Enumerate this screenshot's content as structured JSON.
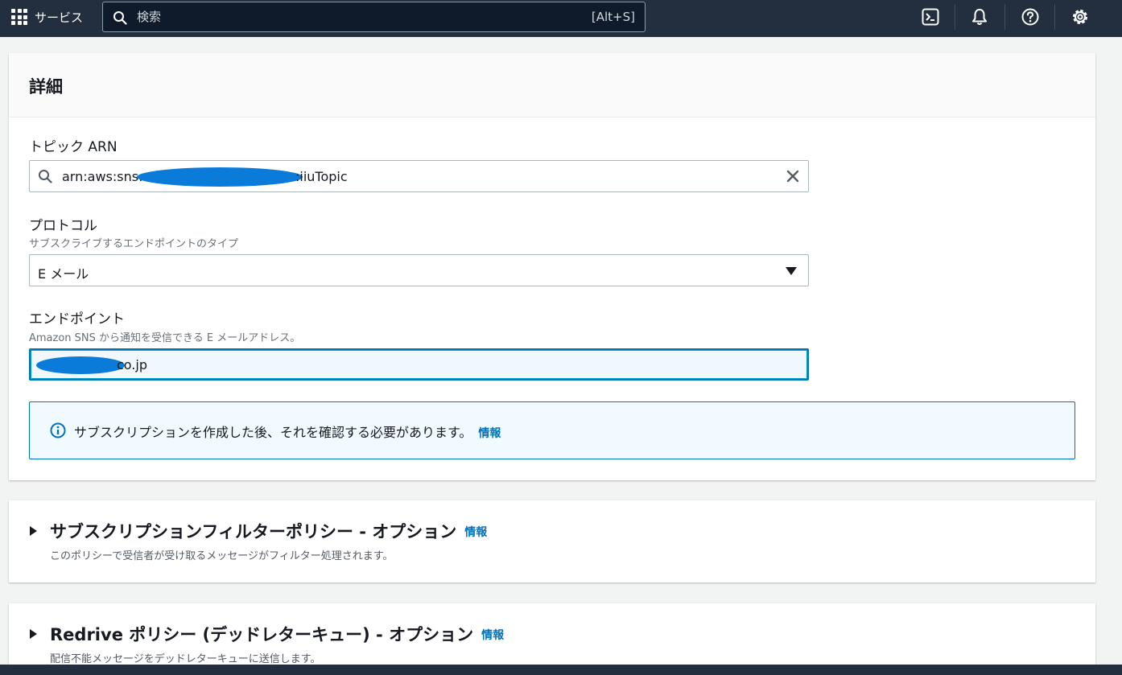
{
  "topnav": {
    "services_label": "サービス",
    "search_placeholder": "検索",
    "search_shortcut": "[Alt+S]",
    "icons": [
      "cloudshell-icon",
      "bell-icon",
      "help-icon",
      "gear-icon"
    ]
  },
  "details": {
    "title": "詳細",
    "topic_arn": {
      "label": "トピック ARN",
      "value_prefix": "arn:aws:sns:",
      "value_suffix": ":iiuTopic"
    },
    "protocol": {
      "label": "プロトコル",
      "description": "サブスクライブするエンドポイントのタイプ",
      "selected": "E メール"
    },
    "endpoint": {
      "label": "エンドポイント",
      "description": "Amazon SNS から通知を受信できる E メールアドレス。",
      "value_suffix": "co.jp"
    },
    "alert": {
      "text": "サブスクリプションを作成した後、それを確認する必要があります。",
      "link": "情報"
    }
  },
  "sections": [
    {
      "title": "サブスクリプションフィルターポリシー - オプション",
      "link": "情報",
      "description": "このポリシーで受信者が受け取るメッセージがフィルター処理されます。"
    },
    {
      "title": "Redrive ポリシー (デッドレターキュー) - オプション",
      "link": "情報",
      "description": "配信不能メッセージをデッドレターキューに送信します。"
    }
  ],
  "colors": {
    "nav_bg": "#232f3e",
    "link": "#0073bb",
    "redaction": "#0a7bd8"
  }
}
